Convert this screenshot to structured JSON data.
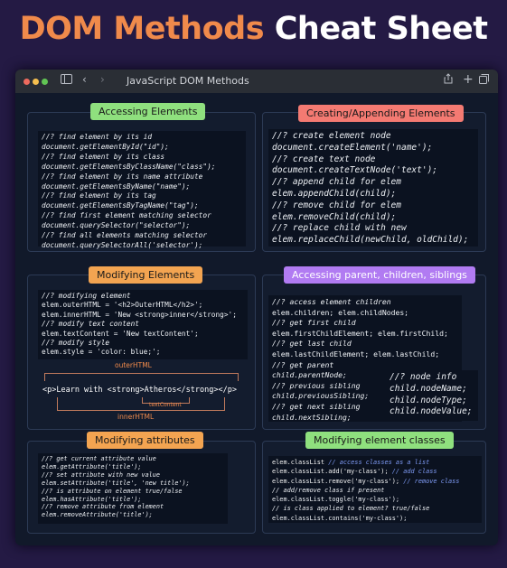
{
  "header": {
    "title_part1": "DOM Methods",
    "title_part2": "Cheat Sheet"
  },
  "window": {
    "title": "JavaScript DOM Methods",
    "icons": [
      "sidebar-icon",
      "back-icon",
      "forward-icon",
      "share-icon",
      "new-tab-icon",
      "tabs-icon"
    ]
  },
  "sections": {
    "accessing": {
      "label": "Accessing Elements",
      "lines": [
        "//? find element by its id",
        "document.getElementById(\"id\");",
        "//? find element by its class",
        "document.getElementsByClassName(\"class\");",
        "//? find element by its name attribute",
        "document.getElementsByName(\"name\");",
        "//? find element by its tag",
        "document.getElementsByTagName(\"tag\");",
        "//? find first element matching selector",
        "document.querySelector(\"selector\");",
        "//? find all elements matching selector",
        "document.querySelectorAll('selector');"
      ]
    },
    "creating": {
      "label": "Creating/Appending Elements",
      "lines": [
        "//? create element node",
        "document.createElement('name');",
        "//? create text node",
        "document.createTextNode('text');",
        "//? append child for elem",
        "elem.appendChild(child);",
        "//? remove child for elem",
        "elem.removeChild(child);",
        "//? replace child with new",
        "elem.replaceChild(newChild, oldChild);"
      ]
    },
    "modifying": {
      "label": "Modifying Elements",
      "lines": [
        "//? modifying element",
        "elem.outerHTML = '<h2>OuterHTML</h2>';",
        "elem.innerHTML = 'New <strong>inner</strong>';",
        "//? modify text content",
        "elem.textContent = 'New textContent';",
        "//? modify style",
        "elem.style = 'color: blue;';"
      ],
      "diagram": {
        "outer_label": "outerHTML",
        "code": "<p>Learn with <strong>Atheros</strong></p>",
        "text_label": "textContent",
        "inner_label": "innerHTML"
      }
    },
    "parent": {
      "label": "Accessing parent, children, siblings",
      "lines": [
        "//? access element children",
        "elem.children; elem.childNodes;",
        "//? get first child",
        "elem.firstChildElement; elem.firstChild;",
        "//? get last child",
        "elem.lastChildElement; elem.lastChild;",
        "//? get parent",
        "child.parentNode;",
        "//? previous sibling",
        "child.previousSibling;",
        "//? get next sibling",
        "child.nextSibling;"
      ],
      "info_lines": [
        "//? node info",
        "child.nodeName;",
        "child.nodeType;",
        "child.nodeValue;"
      ]
    },
    "attributes": {
      "label": "Modifying attributes",
      "lines": [
        "//? get current attribute value",
        "elem.getAttribute('title');",
        "//? set attribute with new value",
        "elem.setAttribute('title', 'new title');",
        "//? is attribute on element true/false",
        "elem.hasAttribute('title');",
        "//? remove attribute from element",
        "elem.removeAttribute('title');"
      ]
    },
    "classes": {
      "label": "Modifying element classes",
      "lines": [
        "elem.classList // access classes as a list",
        "elem.classList.add('my-class'); // add class",
        "elem.classList.remove('my-class'); // remove class",
        "// add/remove class if present",
        "elem.classList.toggle('my-class');",
        "// is class applied to element? true/false",
        "elem.classList.contains('my-class');"
      ]
    }
  }
}
